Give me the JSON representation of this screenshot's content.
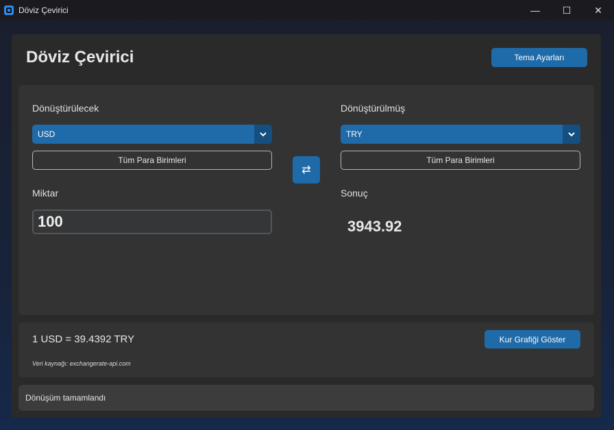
{
  "window": {
    "title": "Döviz Çevirici",
    "minimize_icon": "—",
    "maximize_icon": "☐",
    "close_icon": "✕"
  },
  "header": {
    "title": "Döviz Çevirici",
    "theme_button": "Tema Ayarları"
  },
  "converter": {
    "from_label": "Dönüştürülecek",
    "from_currency": "USD",
    "to_label": "Dönüştürülmüş",
    "to_currency": "TRY",
    "all_currencies_button": "Tüm Para Birimleri",
    "swap_icon": "⇄",
    "amount_label": "Miktar",
    "amount_value": "100",
    "result_label": "Sonuç",
    "result_value": "3943.92"
  },
  "rate_panel": {
    "rate_text": "1 USD = 39.4392 TRY",
    "chart_button": "Kur Grafiği Göster",
    "source_text": "Veri kaynağı: exchangerate-api.com"
  },
  "status": {
    "text": "Dönüşüm tamamlandı"
  },
  "colors": {
    "accent": "#1f6aa8",
    "accent_dark": "#144f80",
    "panel": "#2a2a2a",
    "card": "#333333"
  }
}
